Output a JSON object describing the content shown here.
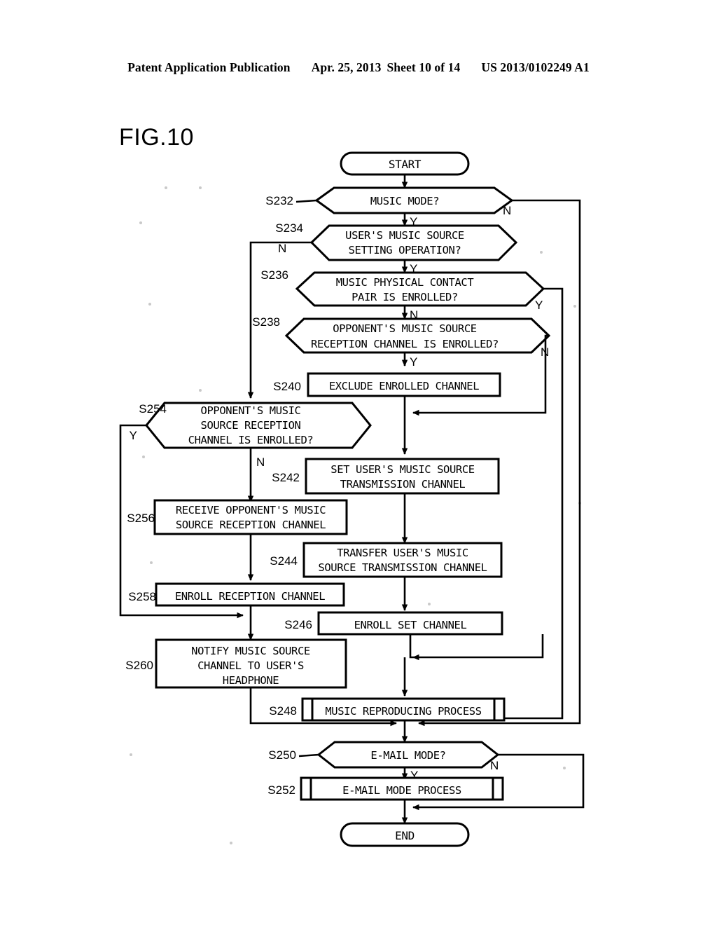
{
  "header": {
    "publication": "Patent Application Publication",
    "date": "Apr. 25, 2013",
    "sheet": "Sheet 10 of 14",
    "patent_number": "US 2013/0102249 A1"
  },
  "figure": {
    "title": "FIG.10"
  },
  "flowchart": {
    "terminators": {
      "start": "START",
      "end": "END"
    },
    "nodes": [
      {
        "id": "S232",
        "step": "S232",
        "type": "decision",
        "lines": [
          "MUSIC MODE?"
        ],
        "yes_label": "Y",
        "no_label": "N"
      },
      {
        "id": "S234",
        "step": "S234",
        "type": "decision",
        "lines": [
          "USER'S MUSIC SOURCE",
          "SETTING OPERATION?"
        ],
        "yes_label": "Y",
        "no_label": "N"
      },
      {
        "id": "S236",
        "step": "S236",
        "type": "decision",
        "lines": [
          "MUSIC PHYSICAL CONTACT",
          "PAIR IS ENROLLED?"
        ],
        "yes_label": "Y",
        "no_label": "N"
      },
      {
        "id": "S238",
        "step": "S238",
        "type": "decision",
        "lines": [
          "OPPONENT'S MUSIC SOURCE",
          "RECEPTION CHANNEL IS ENROLLED?"
        ],
        "yes_label": "Y",
        "no_label": "N"
      },
      {
        "id": "S240",
        "step": "S240",
        "type": "process",
        "lines": [
          "EXCLUDE ENROLLED CHANNEL"
        ]
      },
      {
        "id": "S254",
        "step": "S254",
        "type": "decision",
        "lines": [
          "OPPONENT'S MUSIC",
          "SOURCE RECEPTION",
          "CHANNEL IS ENROLLED?"
        ],
        "yes_label": "Y",
        "no_label": "N"
      },
      {
        "id": "S242",
        "step": "S242",
        "type": "process",
        "lines": [
          "SET USER'S MUSIC SOURCE",
          "TRANSMISSION CHANNEL"
        ]
      },
      {
        "id": "S256",
        "step": "S256",
        "type": "process",
        "lines": [
          "RECEIVE OPPONENT'S MUSIC",
          "SOURCE RECEPTION CHANNEL"
        ]
      },
      {
        "id": "S244",
        "step": "S244",
        "type": "process",
        "lines": [
          "TRANSFER USER'S MUSIC",
          "SOURCE TRANSMISSION CHANNEL"
        ]
      },
      {
        "id": "S258",
        "step": "S258",
        "type": "process",
        "lines": [
          "ENROLL RECEPTION CHANNEL"
        ]
      },
      {
        "id": "S246",
        "step": "S246",
        "type": "process",
        "lines": [
          "ENROLL SET CHANNEL"
        ]
      },
      {
        "id": "S260",
        "step": "S260",
        "type": "process",
        "lines": [
          "NOTIFY MUSIC SOURCE",
          "CHANNEL TO USER'S",
          "HEADPHONE"
        ]
      },
      {
        "id": "S248",
        "step": "S248",
        "type": "predefined-process",
        "lines": [
          "MUSIC REPRODUCING PROCESS"
        ]
      },
      {
        "id": "S250",
        "step": "S250",
        "type": "decision",
        "lines": [
          "E-MAIL MODE?"
        ],
        "yes_label": "Y",
        "no_label": "N"
      },
      {
        "id": "S252",
        "step": "S252",
        "type": "predefined-process",
        "lines": [
          "E-MAIL MODE PROCESS"
        ]
      }
    ],
    "branch_labels": {
      "s232_n": "N",
      "s232_y": "Y",
      "s234_n": "N",
      "s234_y": "Y",
      "s236_y": "Y",
      "s236_n": "N",
      "s238_n": "N",
      "s238_y": "Y",
      "s254_y": "Y",
      "s254_n": "N",
      "s250_n": "N",
      "s250_y": "Y"
    }
  },
  "colors": {
    "ink": "#000000",
    "paper": "#ffffff"
  }
}
